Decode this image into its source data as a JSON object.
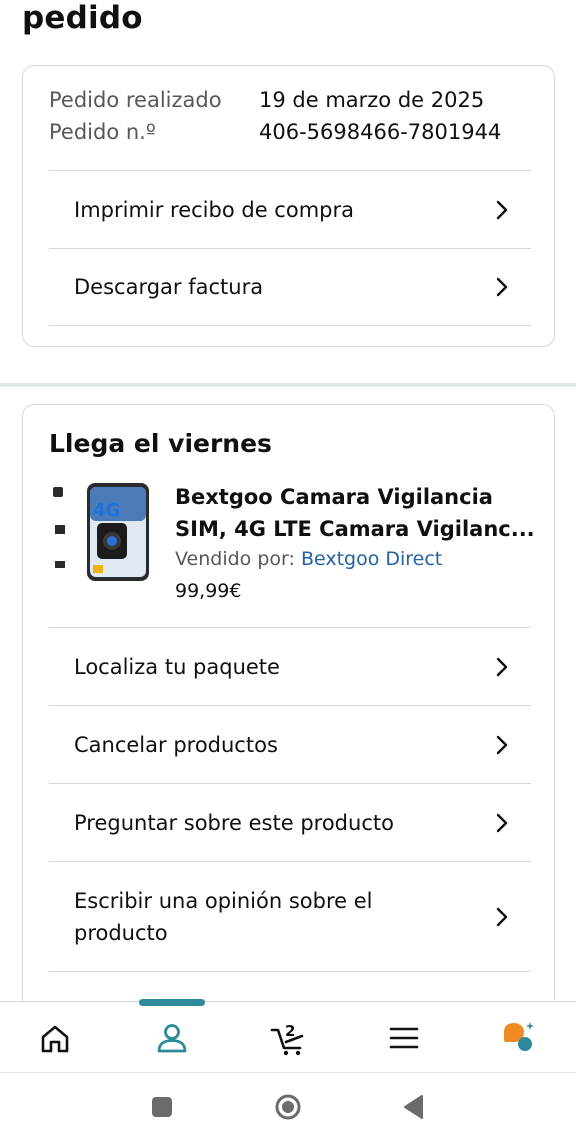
{
  "page": {
    "title": "pedido"
  },
  "order_info": {
    "placed_label": "Pedido realizado",
    "placed_value": "19 de marzo de 2025",
    "number_label": "Pedido n.º",
    "number_value": "406-5698466-7801944"
  },
  "order_actions": [
    {
      "label": "Imprimir recibo de compra"
    },
    {
      "label": "Descargar factura"
    }
  ],
  "delivery": {
    "title": "Llega el viernes",
    "product": {
      "title": "Bextgoo Camara Vigilancia SIM, 4G LTE Camara Vigilanc...",
      "seller_label": "Vendido por:",
      "seller_name": "Bextgoo Direct",
      "price": "99,99€",
      "image_badge": "4G"
    },
    "actions": [
      {
        "label": "Localiza tu paquete"
      },
      {
        "label": "Cancelar productos"
      },
      {
        "label": "Preguntar sobre este producto"
      },
      {
        "label": "Escribir una opinión sobre el producto"
      }
    ]
  },
  "bottom_nav": {
    "items": [
      {
        "icon": "home-icon"
      },
      {
        "icon": "account-icon",
        "active": true
      },
      {
        "icon": "cart-icon",
        "badge": "2"
      },
      {
        "icon": "menu-icon"
      },
      {
        "icon": "rufus-assistant-icon"
      }
    ],
    "accent_color": "#2e8a9a"
  },
  "system_nav": {
    "icons": [
      "recents-icon",
      "home-circle-icon",
      "back-icon"
    ]
  },
  "colors": {
    "link": "#2162a1",
    "secondary_text": "#565959",
    "border": "#d5d9d9",
    "rufus_orange": "#f08a24"
  }
}
